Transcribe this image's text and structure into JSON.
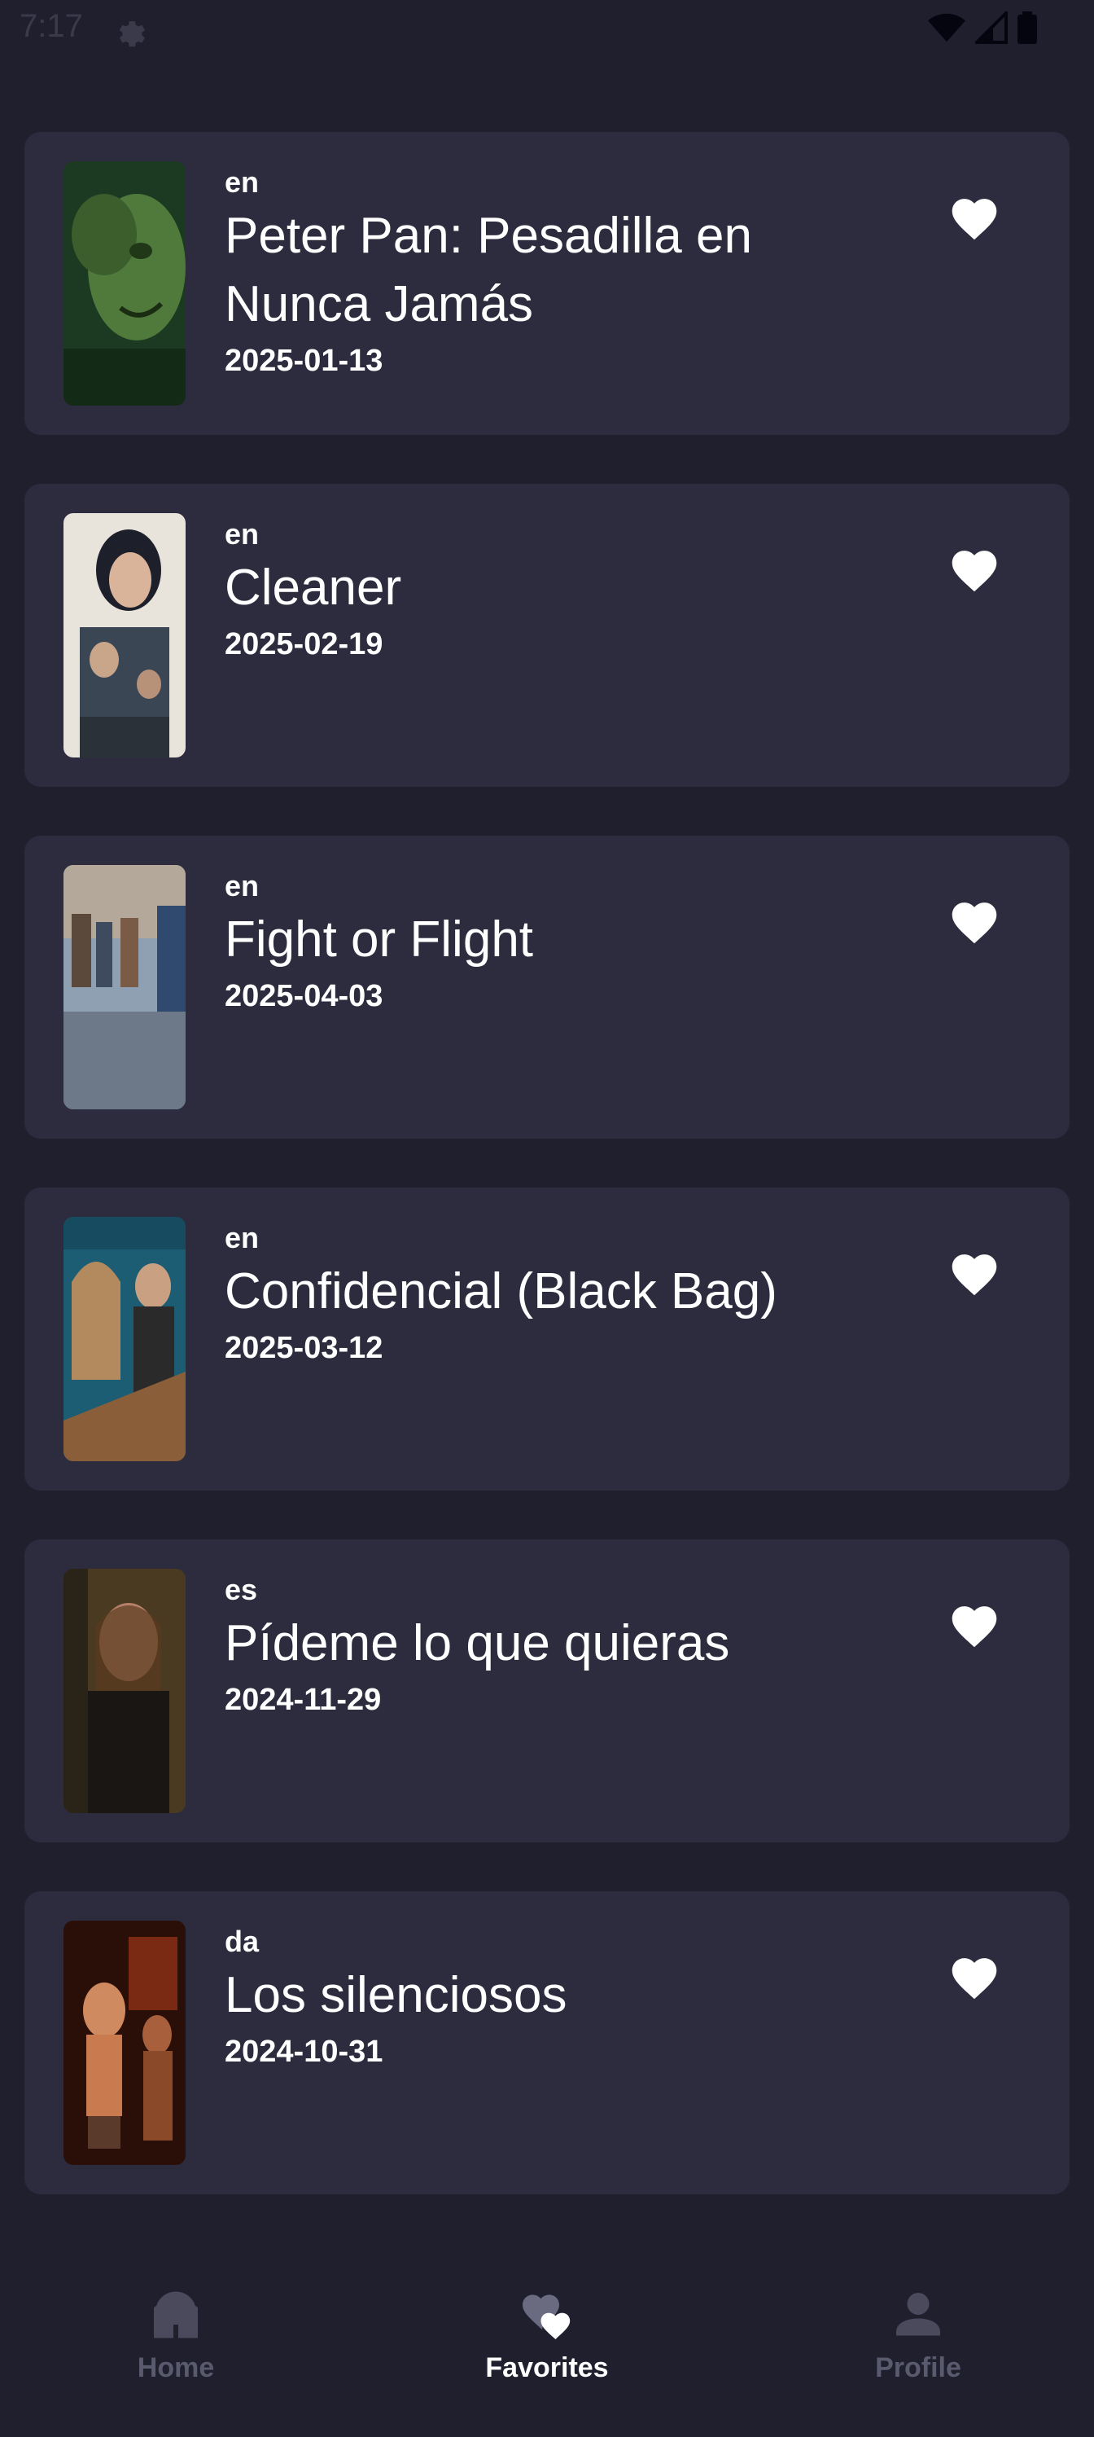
{
  "status_bar": {
    "time": "7:17",
    "icons": [
      "gear-icon",
      "wifi-icon",
      "signal-icon",
      "battery-icon"
    ]
  },
  "movies": [
    {
      "lang": "en",
      "title": "Peter Pan: Pesadilla en Nunca Jamás",
      "date": "2025-01-13",
      "favorite": true
    },
    {
      "lang": "en",
      "title": "Cleaner",
      "date": "2025-02-19",
      "favorite": true
    },
    {
      "lang": "en",
      "title": "Fight or Flight",
      "date": "2025-04-03",
      "favorite": true
    },
    {
      "lang": "en",
      "title": "Confidencial (Black Bag)",
      "date": "2025-03-12",
      "favorite": true
    },
    {
      "lang": "es",
      "title": "Pídeme lo que quieras",
      "date": "2024-11-29",
      "favorite": true
    },
    {
      "lang": "da",
      "title": "Los silenciosos",
      "date": "2024-10-31",
      "favorite": true
    }
  ],
  "nav": {
    "home": "Home",
    "favorites": "Favorites",
    "profile": "Profile",
    "active": "favorites"
  },
  "colors": {
    "background": "#1f1f2e",
    "card": "#2c2c3e",
    "text": "#ffffff",
    "inactive": "#5a5a6e"
  }
}
